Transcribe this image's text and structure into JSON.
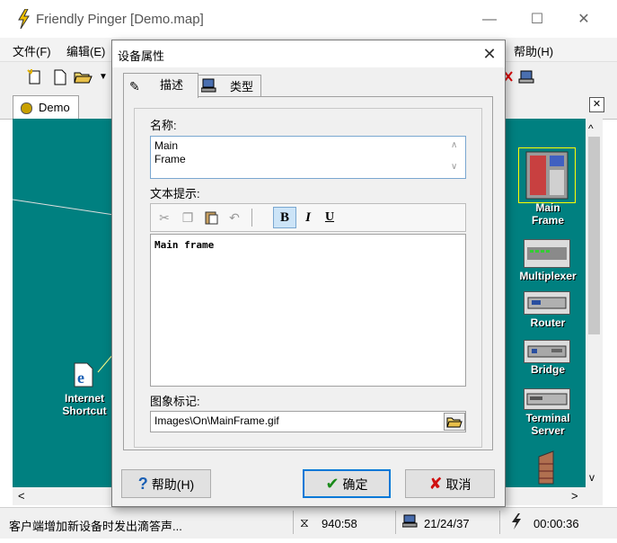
{
  "window": {
    "title": "Friendly Pinger [Demo.map]",
    "controls": {
      "minimize": "—",
      "maximize": "☐",
      "close": "✕"
    }
  },
  "menu": [
    {
      "label": "文件(F)"
    },
    {
      "label": "编辑(E)"
    },
    {
      "label": "帮助(H)"
    }
  ],
  "document_tab": {
    "label": "Demo",
    "close": "✕"
  },
  "map": {
    "shortcut": {
      "line1": "Internet",
      "line2": "Shortcut"
    }
  },
  "palette": [
    {
      "line1": "Main",
      "line2": "Frame",
      "icon": "mainframe-icon"
    },
    {
      "line1": "Multiplexer",
      "line2": "",
      "icon": "multiplexer-icon"
    },
    {
      "line1": "Router",
      "line2": "",
      "icon": "router-icon"
    },
    {
      "line1": "Bridge",
      "line2": "",
      "icon": "bridge-icon"
    },
    {
      "line1": "Terminal",
      "line2": "Server",
      "icon": "terminal-server-icon"
    }
  ],
  "scroll": {
    "up": "^",
    "down": "v",
    "left": "<",
    "right": ">"
  },
  "status": {
    "message": "客户端增加新设备时发出滴答声...",
    "ping": "940:58",
    "counts": "21/24/37",
    "time": "00:00:36"
  },
  "dialog": {
    "title": "设备属性",
    "close": "✕",
    "tabs": [
      {
        "label": "描述",
        "icon": "description-icon"
      },
      {
        "label": "类型",
        "icon": "computer-icon"
      }
    ],
    "name_label": "名称:",
    "name_value": "Main\nFrame",
    "hint_label": "文本提示:",
    "hint_toolbar": {
      "bold": "B",
      "italic": "I",
      "underline": "U"
    },
    "hint_value": "Main frame",
    "image_label": "图象标记:",
    "image_path": "Images\\On\\MainFrame.gif",
    "buttons": {
      "help": "帮助(H)",
      "ok": "确定",
      "cancel": "取消"
    }
  },
  "colors": {
    "map_bg": "#008080",
    "accent": "#0078d7"
  }
}
